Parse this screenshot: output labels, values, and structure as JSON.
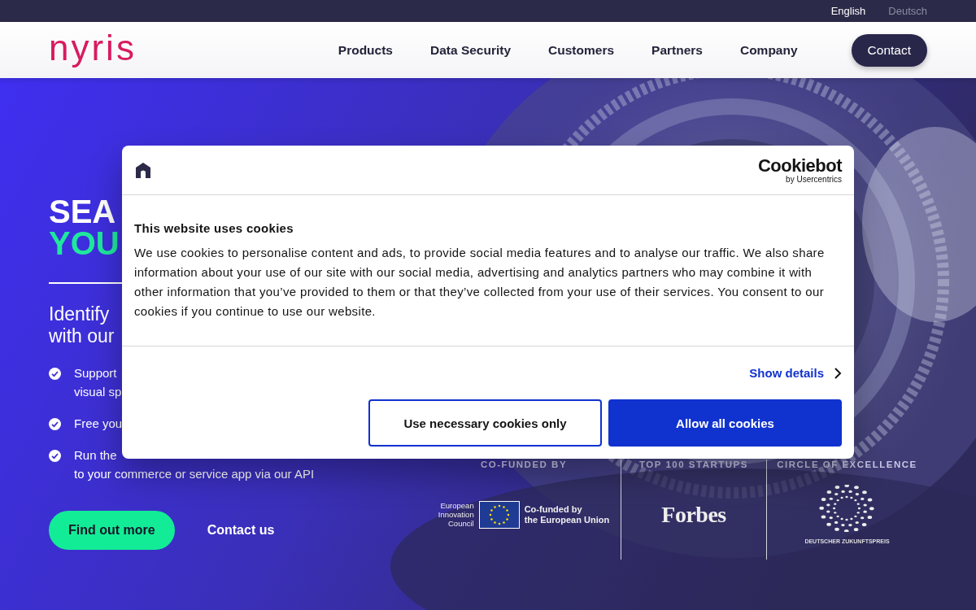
{
  "top_bar": {
    "languages": [
      {
        "label": "English",
        "selected": true
      },
      {
        "label": "Deutsch",
        "selected": false
      }
    ]
  },
  "nav": {
    "logo": "nyris",
    "items": [
      "Products",
      "Data Security",
      "Customers",
      "Partners",
      "Company"
    ],
    "contact_button": "Contact"
  },
  "hero": {
    "heading_lines": [
      {
        "text": "SEA",
        "kind": "plain"
      },
      {
        "text": "YOU",
        "kind": "accent"
      }
    ],
    "subtitle_lines": [
      "Identify",
      "with our"
    ],
    "bullets": [
      {
        "lines": [
          "Support",
          "visual sp"
        ]
      },
      {
        "lines": [
          "Free you"
        ]
      },
      {
        "lines": [
          "Run the",
          "to your commerce or service app via our API"
        ]
      }
    ],
    "primary_button": "Find out more",
    "secondary_link": "Contact us",
    "awards": [
      {
        "label": "CO-FUNDED BY",
        "kind": "eu",
        "left_text": [
          "European",
          "Innovation",
          "Council"
        ],
        "right_text": [
          "Co-funded by",
          "the European Union"
        ]
      },
      {
        "label": "TOP 100 STARTUPS",
        "kind": "forbes",
        "logo_text": "Forbes"
      },
      {
        "label": "CIRCLE OF EXCELLENCE",
        "kind": "prize",
        "logo_text": "DEUTSCHER ZUKUNFTSPREIS"
      }
    ]
  },
  "cookie_dialog": {
    "brand": "Cookiebot",
    "brand_sub": "by Usercentrics",
    "title": "This website uses cookies",
    "body": "We use cookies to personalise content and ads, to provide social media features and to analyse our traffic. We also share information about your use of our site with our social media, advertising and analytics partners who may combine it with other information that you’ve provided to them or that they’ve collected from your use of their services. You consent to our cookies if you continue to use our website.",
    "details_link": "Show details",
    "buttons": [
      {
        "label": "Use necessary cookies only",
        "kind": "outline"
      },
      {
        "label": "Allow all cookies",
        "kind": "filled"
      }
    ]
  }
}
